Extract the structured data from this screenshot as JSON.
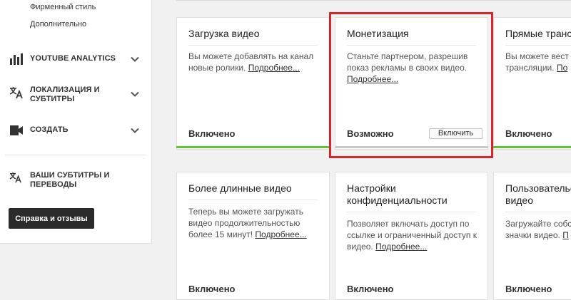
{
  "sidebar": {
    "sub_links": [
      "Фирменный стиль",
      "Дополнительно"
    ],
    "items": [
      {
        "label": "YOUTUBE ANALYTICS",
        "icon": "bar-chart-icon"
      },
      {
        "label": "ЛОКАЛИЗАЦИЯ И СУБТИТРЫ",
        "icon": "translate-icon"
      },
      {
        "label": "СОЗДАТЬ",
        "icon": "video-camera-icon"
      }
    ],
    "subtitles_item": {
      "label": "ВАШИ СУБТИТРЫ И ПЕРЕВОДЫ",
      "icon": "translate-icon"
    },
    "help_button": "Справка и отзывы"
  },
  "cards": [
    {
      "title": "Загрузка видео",
      "desc": "Вы можете добавлять на канал новые ролики.",
      "link": "Подробнее...",
      "status": "Включено",
      "bar_color": "#5ec532"
    },
    {
      "title": "Монетизация",
      "desc": "Станьте партнером, разрешив показ рекламы в своих видео.",
      "link": "Подробнее...",
      "status": "Возможно",
      "button": "Включить",
      "bar_color": "#c9c9c9"
    },
    {
      "title": "Прямые транс",
      "desc": "Вы можете вест трансляции.",
      "link": "По",
      "status": "Включено",
      "bar_color": "#5ec532"
    },
    {
      "title": "Более длинные видео",
      "desc": "Теперь вы можете загружать видео продолжительностью более 15 минут!",
      "link": "Подробнее...",
      "status": "Включено"
    },
    {
      "title": "Настройки конфиденциальности",
      "desc": "Позволяет включать доступ по ссылке и ограниченный доступ к видео.",
      "link": "Подробнее...",
      "status": "Включено"
    },
    {
      "title": "Пользовательские видео",
      "desc": "Загружайте собс значки видео.",
      "link": "П",
      "status": "Включено"
    }
  ],
  "colors": {
    "enabled_bar": "#5ec532",
    "highlight": "#d6262e",
    "help_button_bg": "#2b2b2b"
  }
}
